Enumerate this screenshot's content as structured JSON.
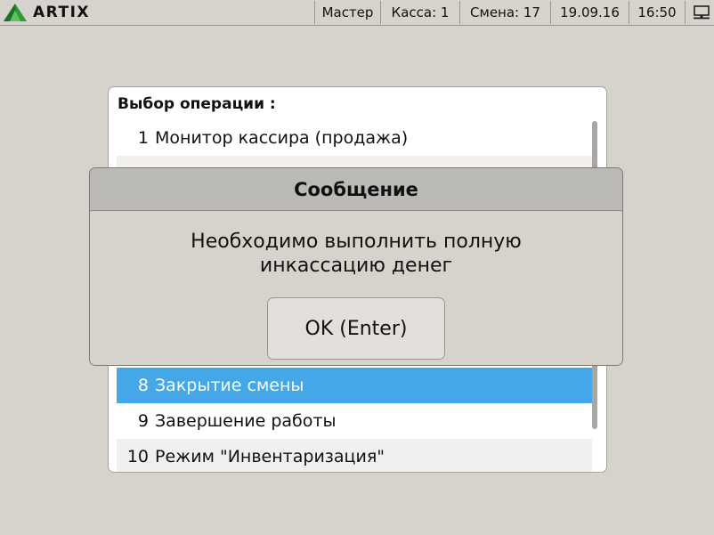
{
  "app": {
    "brand": "ARTIX"
  },
  "status": {
    "user": "Мастер",
    "kassa": "Касса: 1",
    "smena": "Смена: 17",
    "date": "19.09.16",
    "time": "16:50",
    "icon": "monitor-network-icon"
  },
  "menu": {
    "title": "Выбор операции :",
    "items": [
      {
        "num": "1",
        "label": "Монитор кассира (продажа)"
      },
      {
        "num": "8",
        "label": "Закрытие смены",
        "selected": true
      },
      {
        "num": "9",
        "label": "Завершение работы"
      },
      {
        "num": "10",
        "label": "Режим \"Инвентаризация\""
      }
    ]
  },
  "dialog": {
    "title": "Сообщение",
    "line1": "Необходимо выполнить полную",
    "line2": "инкассацию денег",
    "ok_label": "OK (Enter)"
  },
  "colors": {
    "background": "#d6d2cc",
    "selection": "#44a7e8",
    "logo_green": "#2e9a3a"
  }
}
